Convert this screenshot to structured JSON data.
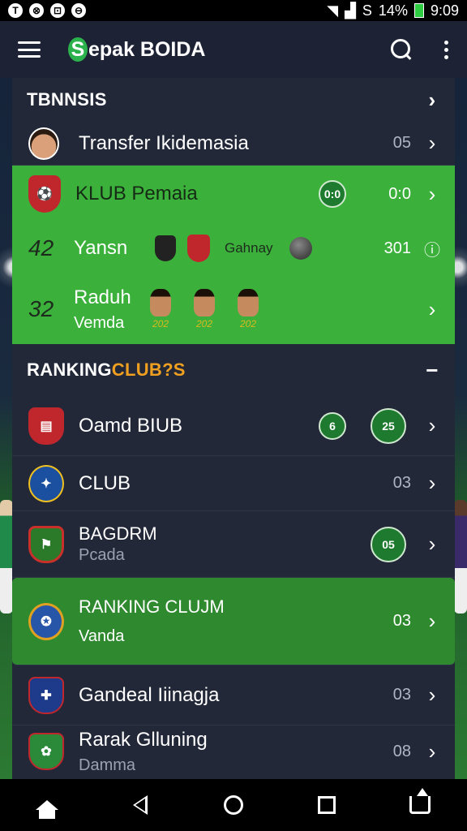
{
  "status_bar": {
    "left_icons": [
      "T",
      "⊗",
      "⊡",
      "⊖"
    ],
    "carrier": "S",
    "battery_text": "14%",
    "time": "9:09"
  },
  "app_bar": {
    "brand_initial": "S",
    "brand_rest": "epak BOIDA",
    "menu_icon": "hamburger-icon",
    "search_icon": "search-icon",
    "more_icon": "overflow-menu-icon"
  },
  "top_section": {
    "title": "TBNNSIS",
    "rows": [
      {
        "name": "Transfer Ikidemasia",
        "value": "05"
      }
    ]
  },
  "klub_block": {
    "title": "KLUB Pemaia",
    "title_value": "0:0",
    "badge_text": "0:0",
    "rows": [
      {
        "rank": "42",
        "name": "Yansn",
        "extra_label": "Gahnay",
        "value": "301"
      },
      {
        "rank": "32",
        "name": "Raduh",
        "sub": "Vemda",
        "faces": [
          "202",
          "202",
          "202"
        ]
      }
    ]
  },
  "ranking_section": {
    "title_main": "RANKING ",
    "title_accent": "CLUB?S",
    "collapse_symbol": "−",
    "rows": [
      {
        "name": "Oamd BIUB",
        "badge1": "6",
        "badge2": "25",
        "crest_color": "#c0272d"
      },
      {
        "name": "CLUB",
        "value": "03",
        "crest_color": "#1b4fa0"
      },
      {
        "name": "BAGDRM",
        "sub": "Pcada",
        "badge": "05",
        "crest_color": "#c8302a"
      },
      {
        "name": "RANKING CLUJM",
        "sub": "Vanda",
        "value": "03",
        "crest_color": "#2756a8"
      },
      {
        "name": "Gandeal Iiinagja",
        "value": "03",
        "crest_color": "#1e3a8a"
      },
      {
        "name": "Rarak Glluning",
        "sub": "Damma",
        "value": "08",
        "crest_color": "#2a8a3a"
      }
    ]
  },
  "nav_bar": {
    "icons": [
      "home-icon",
      "back-icon",
      "circle-home-icon",
      "recents-icon",
      "share-icon"
    ]
  },
  "colors": {
    "app_bar": "#1e2235",
    "panel": "#232839",
    "green_block": "#3bb13b",
    "green_row": "#2f8a2f",
    "accent_orange": "#f0a020"
  }
}
